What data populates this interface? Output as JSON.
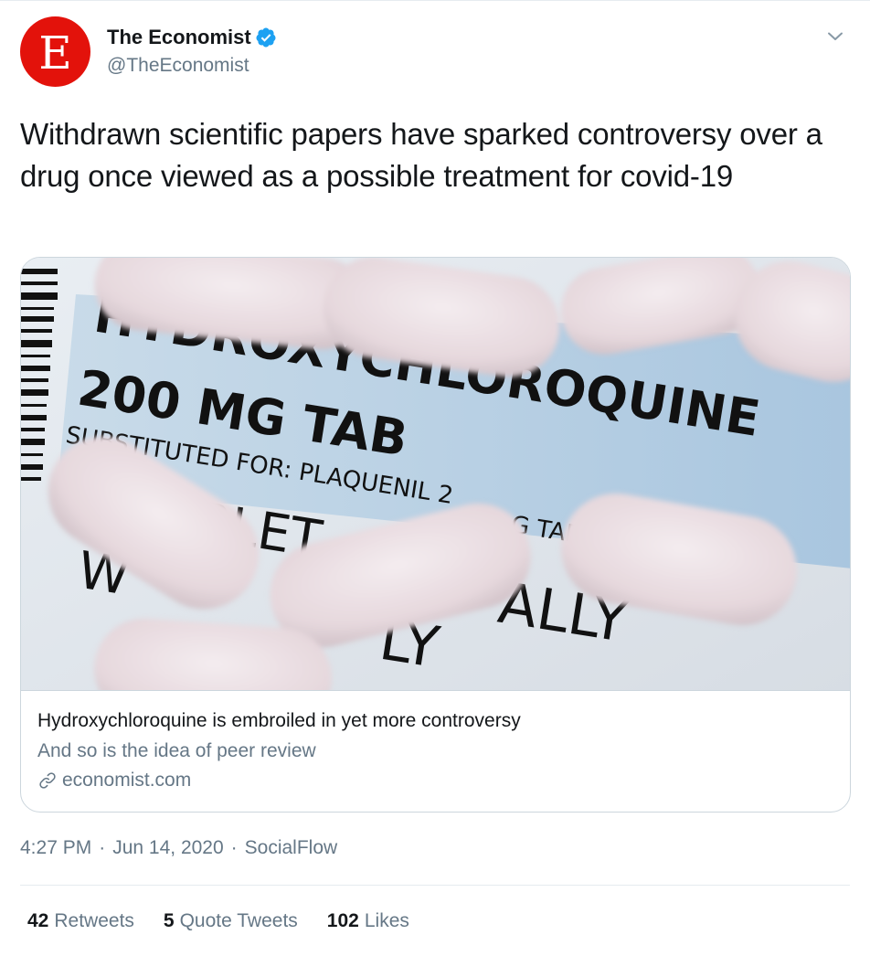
{
  "author": {
    "display_name": "The Economist",
    "handle": "@TheEconomist",
    "avatar_letter": "E",
    "avatar_color": "#e3120b",
    "verified": true,
    "verified_color": "#1da1f2"
  },
  "tweet": {
    "text": "Withdrawn scientific papers have sparked controversy over a drug once viewed as a possible treatment for covid-19"
  },
  "card": {
    "image": {
      "label_line1": "HYDROXYCHLOROQUINE",
      "label_line2": "200 MG TAB",
      "label_line3": "SUBSTITUTED FOR: PLAQUENIL 2",
      "label_line3b": "G TAB",
      "label_fragment_a": "ABLET",
      "label_fragment_b": "ALLY",
      "label_fragment_c": "LY",
      "label_fragment_d": "W"
    },
    "title": "Hydroxychloroquine is embroiled in yet more controversy",
    "description": "And so is the idea of peer review",
    "domain": "economist.com"
  },
  "meta": {
    "time": "4:27 PM",
    "date": "Jun 14, 2020",
    "source": "SocialFlow"
  },
  "stats": {
    "retweets_count": "42",
    "retweets_label": "Retweets",
    "quotes_count": "5",
    "quotes_label": "Quote Tweets",
    "likes_count": "102",
    "likes_label": "Likes"
  }
}
